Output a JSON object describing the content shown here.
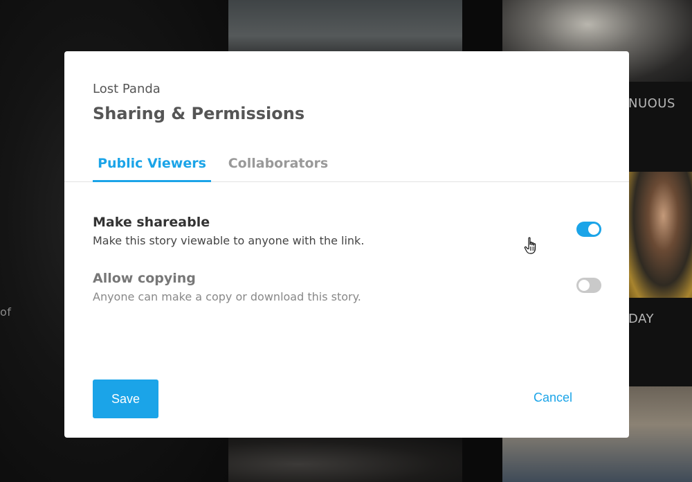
{
  "background": {
    "tile_text_1": "NUOUS",
    "tile_text_2": "DAY",
    "tile_text_3": "of"
  },
  "modal": {
    "subtitle": "Lost Panda",
    "title": "Sharing & Permissions",
    "tabs": [
      {
        "label": "Public Viewers",
        "active": true
      },
      {
        "label": "Collaborators",
        "active": false
      }
    ],
    "settings": [
      {
        "label": "Make shareable",
        "description": "Make this story viewable to anyone with the link.",
        "enabled": true
      },
      {
        "label": "Allow copying",
        "description": "Anyone can make a copy or download this story.",
        "enabled": false
      }
    ],
    "save_label": "Save",
    "cancel_label": "Cancel"
  },
  "colors": {
    "accent": "#1ba4e8",
    "toggle_off": "#c9c9c9",
    "text_dark": "#333333",
    "text_muted": "#888888"
  },
  "icons": {
    "cursor": "hand-pointer-icon"
  }
}
